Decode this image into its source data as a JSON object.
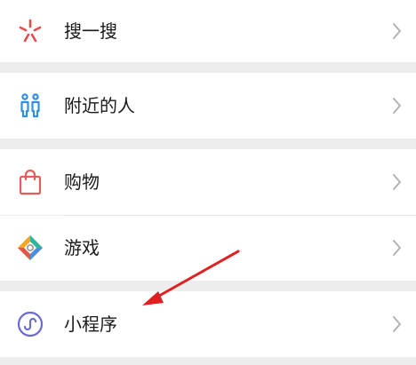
{
  "menu": {
    "items": [
      {
        "label": "搜一搜",
        "icon": "search-spark-icon"
      },
      {
        "label": "附近的人",
        "icon": "people-nearby-icon"
      },
      {
        "label": "购物",
        "icon": "shopping-bag-icon"
      },
      {
        "label": "游戏",
        "icon": "game-diamond-icon"
      },
      {
        "label": "小程序",
        "icon": "mini-program-icon"
      }
    ]
  },
  "colors": {
    "background": "#ededed",
    "row": "#ffffff",
    "search_icon": "#e84b4b",
    "people_icon": "#2f8fe6",
    "shopping_icon": "#e65c5c",
    "mini_program_icon": "#6b6bd6",
    "annotation_arrow": "#e02020",
    "chevron": "#b3b3b3"
  },
  "annotation": {
    "type": "arrow",
    "points_to": "小程序"
  }
}
